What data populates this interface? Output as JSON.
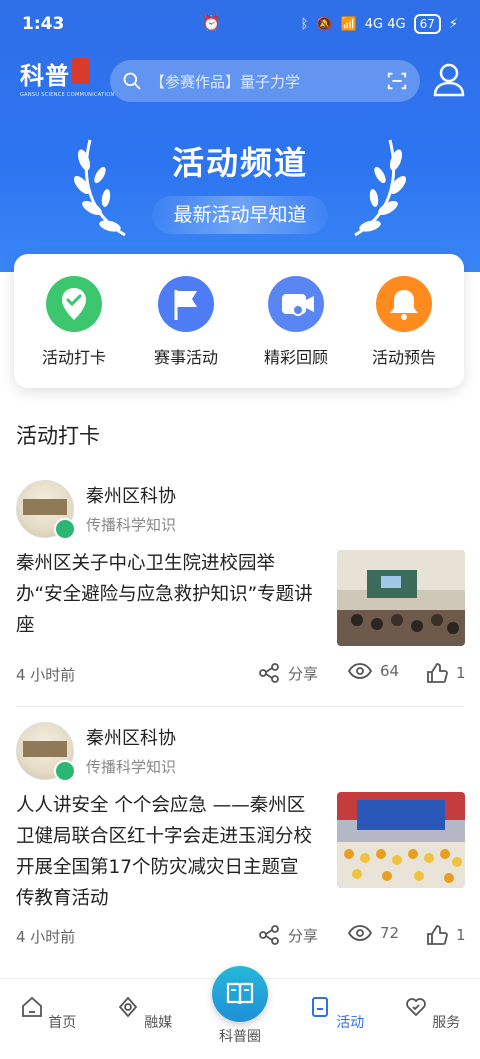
{
  "status_bar": {
    "time": "1:43",
    "network": "4G 4G",
    "battery": "67"
  },
  "header": {
    "logo_text": "科普",
    "logo_subtitle": "GANSU SCIENCE COMMUNICATION",
    "search_placeholder": "【参赛作品】量子力学"
  },
  "banner": {
    "title": "活动频道",
    "subtitle": "最新活动早知道"
  },
  "categories": [
    {
      "label": "活动打卡",
      "icon": "location-check-icon",
      "color": "#3cc66e"
    },
    {
      "label": "赛事活动",
      "icon": "flag-icon",
      "color": "#4d7cf4"
    },
    {
      "label": "精彩回顾",
      "icon": "video-camera-icon",
      "color": "#5a86f3"
    },
    {
      "label": "活动预告",
      "icon": "bell-icon",
      "color": "#ff8a1e"
    }
  ],
  "section_title": "活动打卡",
  "posts": [
    {
      "author": "秦州区科协",
      "author_desc": "传播科学知识",
      "text": "秦州区关子中心卫生院进校园举办“安全避险与应急救护知识”专题讲座",
      "time": "4 小时前",
      "share_label": "分享",
      "views": "64",
      "likes": "1"
    },
    {
      "author": "秦州区科协",
      "author_desc": "传播科学知识",
      "text": "人人讲安全 个个会应急 ——秦州区卫健局联合区红十字会走进玉润分校开展全国第17个防灾减灾日主题宣传教育活动",
      "time": "4 小时前",
      "share_label": "分享",
      "views": "72",
      "likes": "1"
    }
  ],
  "bottom_nav": [
    {
      "label": "首页",
      "icon": "home-icon"
    },
    {
      "label": "融媒",
      "icon": "media-icon"
    },
    {
      "label": "科普圈",
      "icon": "book-icon"
    },
    {
      "label": "活动",
      "icon": "bookmark-icon",
      "active": true
    },
    {
      "label": "服务",
      "icon": "heart-hand-icon"
    }
  ],
  "colors": {
    "brand_blue": "#2f6fe8",
    "active_nav": "#2f6fe8",
    "verified_green": "#2bb673"
  }
}
